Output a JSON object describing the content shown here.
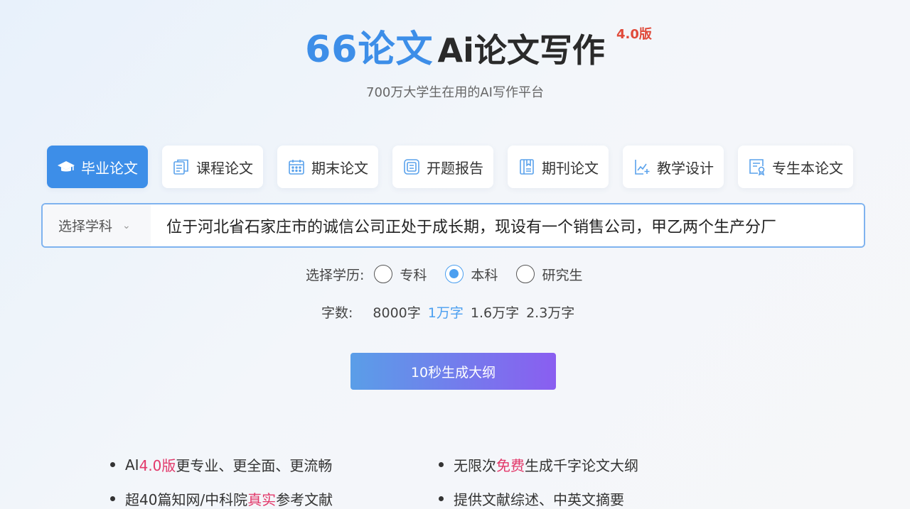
{
  "header": {
    "brand": "66论文",
    "product": "Ai论文写作",
    "version": "4.0版",
    "subtitle": "700万大学生在用的AI写作平台"
  },
  "tabs": [
    {
      "label": "毕业论文",
      "icon": "graduation-cap-icon",
      "active": true
    },
    {
      "label": "课程论文",
      "icon": "documents-icon",
      "active": false
    },
    {
      "label": "期末论文",
      "icon": "calendar-icon",
      "active": false
    },
    {
      "label": "开题报告",
      "icon": "report-icon",
      "active": false
    },
    {
      "label": "期刊论文",
      "icon": "journal-icon",
      "active": false
    },
    {
      "label": "教学设计",
      "icon": "chart-plus-icon",
      "active": false
    },
    {
      "label": "专生本论文",
      "icon": "certificate-icon",
      "active": false
    }
  ],
  "search": {
    "subject_label": "选择学科",
    "value": "位于河北省石家庄市的诚信公司正处于成长期，现设有一个销售公司，甲乙两个生产分厂"
  },
  "education": {
    "label": "选择学历:",
    "options": [
      "专科",
      "本科",
      "研究生"
    ],
    "selected": "本科"
  },
  "word_count": {
    "label": "字数:",
    "options": [
      "8000字",
      "1万字",
      "1.6万字",
      "2.3万字"
    ],
    "selected": "1万字"
  },
  "generate_button": "10秒生成大纲",
  "features": [
    {
      "pre": "AI",
      "hl": "4.0版",
      "post": "更专业、更全面、更流畅"
    },
    {
      "pre": "无限次",
      "hl": "免费",
      "post": "生成千字论文大纲"
    },
    {
      "pre": "超40篇知网/中科院",
      "hl": "真实",
      "post": "参考文献"
    },
    {
      "pre": "提供文献综述、中英文摘要",
      "hl": "",
      "post": ""
    }
  ],
  "colors": {
    "accent": "#3d8ee8",
    "highlight": "#e2386a",
    "version": "#e04a3a",
    "button_start": "#5a9ee8",
    "button_end": "#8a5ef0"
  }
}
